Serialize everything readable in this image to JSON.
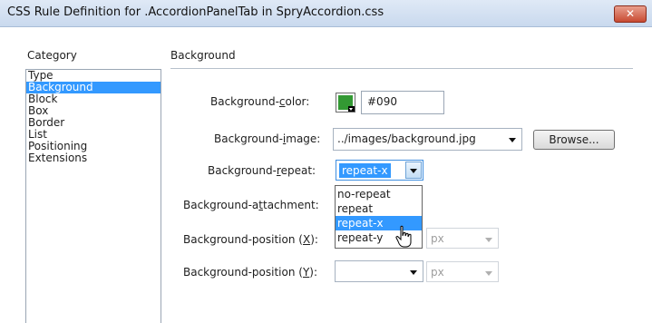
{
  "window": {
    "title": "CSS Rule Definition for .AccordionPanelTab in SpryAccordion.css",
    "close_label": "✕"
  },
  "category": {
    "header": "Category",
    "items": [
      "Type",
      "Background",
      "Block",
      "Box",
      "Border",
      "List",
      "Positioning",
      "Extensions"
    ],
    "selected": "Background"
  },
  "panel": {
    "title": "Background",
    "color": {
      "label_pre": "Background-",
      "label_key": "c",
      "label_post": "olor:",
      "value": "#090",
      "swatch_hex": "#339933"
    },
    "image": {
      "label_pre": "Background-",
      "label_key": "i",
      "label_post": "mage:",
      "value": "../images/background.jpg",
      "browse_label": "Browse..."
    },
    "repeat": {
      "label_pre": "Background-",
      "label_key": "r",
      "label_post": "epeat:",
      "value": "repeat-x",
      "options": [
        "no-repeat",
        "repeat",
        "repeat-x",
        "repeat-y"
      ],
      "hovered": "repeat-x"
    },
    "attachment": {
      "label_pre": "Background-a",
      "label_key": "t",
      "label_post": "tachment:"
    },
    "position_x": {
      "label_pre": "Background-position (",
      "label_key": "X",
      "label_post": "):",
      "unit": "px"
    },
    "position_y": {
      "label_pre": "Background-position (",
      "label_key": "Y",
      "label_post": "):",
      "unit": "px"
    }
  },
  "colors": {
    "selection": "#3399ff",
    "title_bar": "#c9d9ee",
    "close": "#c84a32"
  }
}
